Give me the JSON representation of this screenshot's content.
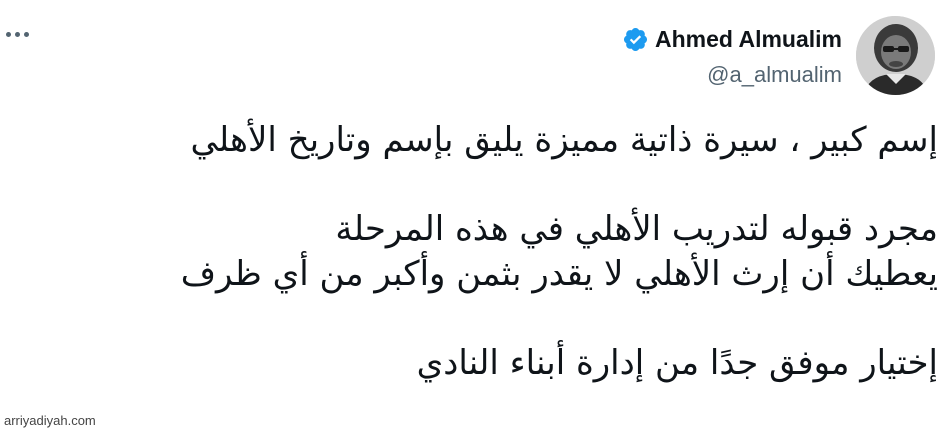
{
  "author": {
    "name": "Ahmed Almualim",
    "handle": "@a_almualim",
    "verified": true,
    "verified_color": "#1d9bf0"
  },
  "menu_icon": "more-dots-icon",
  "tweet_lines": [
    "إسم كبير ، سيرة ذاتية مميزة يليق بإسم وتاريخ الأهلي",
    "مجرد قبوله لتدريب الأهلي في هذه المرحلة",
    "يعطيك أن إرث الأهلي لا يقدر بثمن وأكبر من أي ظرف",
    "إختيار موفق جدًا من إدارة أبناء النادي"
  ],
  "watermark": "arriyadiyah.com"
}
